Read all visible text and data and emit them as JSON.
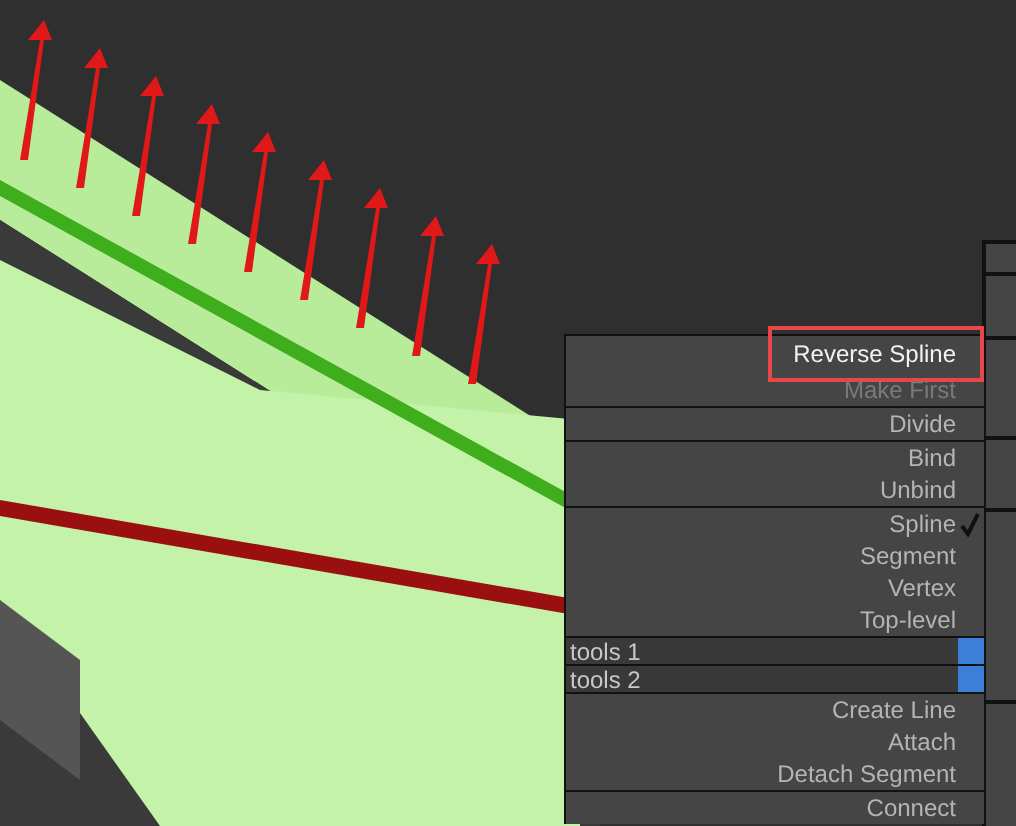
{
  "quad_menu": {
    "items": [
      {
        "kind": "item",
        "label": "Reverse Spline",
        "highlighted": true,
        "disabled": false,
        "checked": false
      },
      {
        "kind": "item",
        "label": "Make First",
        "highlighted": false,
        "disabled": true,
        "checked": false
      },
      {
        "kind": "divider"
      },
      {
        "kind": "item",
        "label": "Divide",
        "highlighted": false,
        "disabled": false,
        "checked": false
      },
      {
        "kind": "divider"
      },
      {
        "kind": "item",
        "label": "Bind",
        "highlighted": false,
        "disabled": false,
        "checked": false
      },
      {
        "kind": "item",
        "label": "Unbind",
        "highlighted": false,
        "disabled": false,
        "checked": false
      },
      {
        "kind": "divider"
      },
      {
        "kind": "item",
        "label": "Spline",
        "highlighted": false,
        "disabled": false,
        "checked": true
      },
      {
        "kind": "item",
        "label": "Segment",
        "highlighted": false,
        "disabled": false,
        "checked": false
      },
      {
        "kind": "item",
        "label": "Vertex",
        "highlighted": false,
        "disabled": false,
        "checked": false
      },
      {
        "kind": "item",
        "label": "Top-level",
        "highlighted": false,
        "disabled": false,
        "checked": false
      },
      {
        "kind": "header",
        "label": "tools 1"
      },
      {
        "kind": "header",
        "label": "tools 2"
      },
      {
        "kind": "item",
        "label": "Create Line",
        "highlighted": false,
        "disabled": false,
        "checked": false
      },
      {
        "kind": "item",
        "label": "Attach",
        "highlighted": false,
        "disabled": false,
        "checked": false
      },
      {
        "kind": "item",
        "label": "Detach Segment",
        "highlighted": false,
        "disabled": false,
        "checked": false
      },
      {
        "kind": "divider"
      },
      {
        "kind": "item",
        "label": "Connect",
        "highlighted": false,
        "disabled": false,
        "checked": false
      }
    ]
  }
}
